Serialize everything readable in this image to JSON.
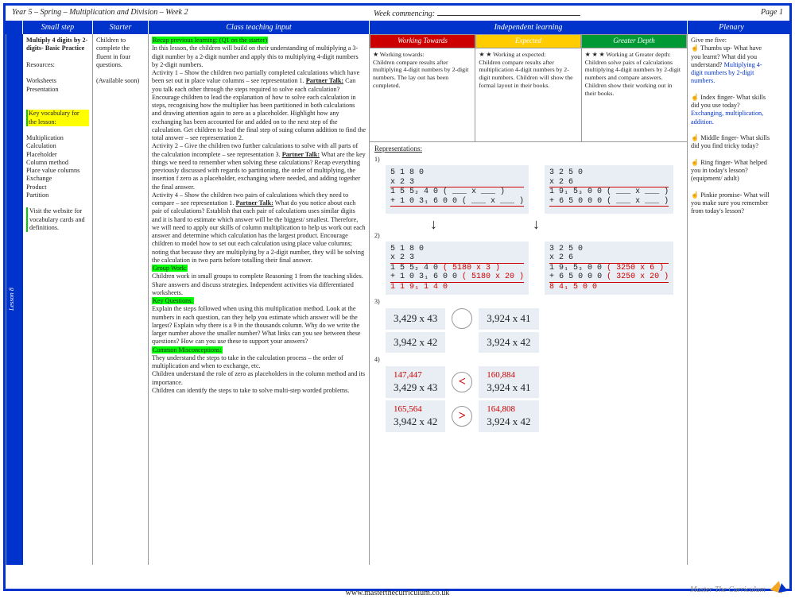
{
  "header": {
    "title": "Year 5 – Spring – Multiplication and Division – Week 2",
    "week_commencing_label": "Week commencing:",
    "page_label": "Page 1"
  },
  "columns": {
    "small_step": "Small step",
    "starter": "Starter",
    "class_teaching": "Class teaching input",
    "independent": "Independent learning",
    "plenary": "Plenary"
  },
  "lesson_label": "Lesson 8",
  "small_step": {
    "title": "Multiply 4 digits by 2-digits- Basic Practice",
    "resources_label": "Resources:",
    "resources": "Worksheets\nPresentation",
    "key_vocab_label": "Key vocabulary for the lesson:",
    "vocab": "Multiplication\nCalculation\nPlaceholder\nColumn method\nPlace value columns\nExchange\nProduct\nPartition",
    "website_note": "Visit the website for vocabulary cards and definitions."
  },
  "starter": {
    "text": "Children to complete the fluent in four questions.",
    "note": "(Available soon)"
  },
  "teaching": {
    "recap_label": "Recap previous learning: (Q1 on the starter)",
    "intro": "In this lesson, the children will build on their understanding of multiplying a 3-digit number by a 2-digit number and apply this to multiplying 4-digit numbers by 2-digit numbers.",
    "activity1": "Activity 1 – Show the children two partially completed calculations which have been set out in place value columns – see representation 1.",
    "partner_talk_label": "Partner Talk:",
    "pt1": "Can you talk each other through the steps required to solve each calculation?  Encourage children to lead the explanation of how to solve each calculation in steps, recognising how the multiplier has been partitioned in both calculations and drawing attention again to zero as a placeholder. Highlight how any exchanging has been accounted for and added on to the next step of the calculation. Get children to lead the final step of suing column addition to find the total answer – see representation 2.",
    "activity2": "Activity 2 – Give the children two further calculations to solve with all parts of the calculation incomplete – see representation 3.",
    "pt2": "What are the key things we need to remember when solving these calculations? Recap everything previously discussed with regards to partitioning, the order of multiplying, the insertion f zero as a placeholder, exchanging where needed, and adding together the final answer.",
    "activity4": "Activity 4 – Show the children two pairs of calculations which they need to compare – see representation 1.",
    "pt4": "What do you notice about each pair of calculations? Establish that each pair of calculations uses similar digits and it is hard to estimate which answer will be the biggest/ smallest. Therefore, we will need to apply our skills of column multiplication to help us work out each answer and determine which calculation has the largest product. Encourage children to model how to set out each calculation using place value columns; noting that because they are multiplying by a 2-digit number, they will be solving the calculation in two parts before totalling their final answer.",
    "group_work_label": "Group Work:",
    "group_work": "Children work in small groups to complete Reasoning 1 from the teaching slides. Share answers and discuss strategies. Independent activities via differentiated worksheets.",
    "key_q_label": "Key Questions:",
    "key_q": "Explain the steps followed when using this multiplication method. Look at the numbers in each question, can they help you estimate which answer will be the largest? Explain why there is a 9 in the thousands column. Why do we write the larger number above the smaller number? What links can you see between these questions? How can you use these to support your answers?",
    "misc_label": "Common Misconceptions:",
    "misc": "They understand the steps to take in the calculation process – the order of multiplication and when to exchange, etc.\nChildren understand the role of  zero as placeholders in the column method and its importance.\nChildren can identify the steps to take to solve multi-step worded problems."
  },
  "independent": {
    "wt_label": "Working Towards",
    "exp_label": "Expected",
    "gd_label": "Greater Depth",
    "wt_text": "★  Working towards:\nChildren compare results after multiplying 4-digit numbers by 2-digit numbers. The lay out has been completed.",
    "exp_text": "★ ★ Working at expected:\nChildren compare results after multiplication 4-digit numbers by 2-digit numbers. Children will show the formal layout in their books.",
    "gd_text": "★ ★ ★ Working at Greater depth:\nChildren solve pairs of calculations multiplying 4-digit numbers by 2-digit numbers and compare answers. Children show their working out in their books.",
    "reps_label": "Representations:",
    "r1_label": "1)",
    "r2_label": "2)",
    "r3_label": "3)",
    "r4_label": "4)",
    "calc1a_l1": "   5  1  8  0",
    "calc1a_l2": "   x        2  3",
    "calc1a_l3": " 1  5  5₂ 4  0 ( ___ x ___ )",
    "calc1a_l4": " 1  0  3₁ 6  0 0 ( ___ x ___ )",
    "calc1b_l1": "   3  2  5  0",
    "calc1b_l2": "   x        2  6",
    "calc1b_l3": " 1  9₁ 5₃ 0  0 ( ___ x ___ )",
    "calc1b_l4": "   6  5  0  0 0 ( ___ x ___ )",
    "calc2a_l3": " 1  5  5₂ 4  0 ( 5180 x 3 )",
    "calc2a_l4": " 1  0  3₁ 6  0 0 ( 5180 x 20 )",
    "calc2a_l5": " 1  1  9₁ 1  4 0",
    "calc2b_l3": " 1  9₁ 5₃ 0  0 ( 3250 x 6 )",
    "calc2b_l4": "   6  5  0  0 0 ( 3250 x 20 )",
    "calc2b_l5": "   8  4₁ 5  0 0",
    "comp3a": "3,429 x 43",
    "comp3b": "3,924 x 41",
    "comp3c": "3,942 x 42",
    "comp3d": "3,924 x 42",
    "comp4a_ans": "147,447",
    "comp4a": "3,429 x 43",
    "comp4b_ans": "160,884",
    "comp4b": "3,924 x 41",
    "comp4c_ans": "165,564",
    "comp4c": "3,942 x 42",
    "comp4d_ans": "164,808",
    "comp4d": "3,924 x 42",
    "lt": "<",
    "gt": ">"
  },
  "plenary": {
    "give_me_five": "Give me five:",
    "thumb_label": "Thumbs up-",
    "thumb": "What have you learnt? What did you understand?",
    "thumb_blue": "Multiplying 4-digit numbers by 2-digit numbers.",
    "index_label": "Index finger-",
    "index": "What skills did you use today?",
    "index_blue": "Exchanging, multiplication, addition.",
    "middle_label": "Middle finger-",
    "middle": "What skills did you find tricky today?",
    "ring_label": "Ring finger-",
    "ring": "What helped you in today's lesson? (equipment/ adult)",
    "pinkie_label": "Pinkie promise-",
    "pinkie": "What will you make sure you remember from today's lesson?"
  },
  "footer": {
    "url": "www.masterthecurriculum.co.uk",
    "brand": "Master The Curriculum"
  }
}
